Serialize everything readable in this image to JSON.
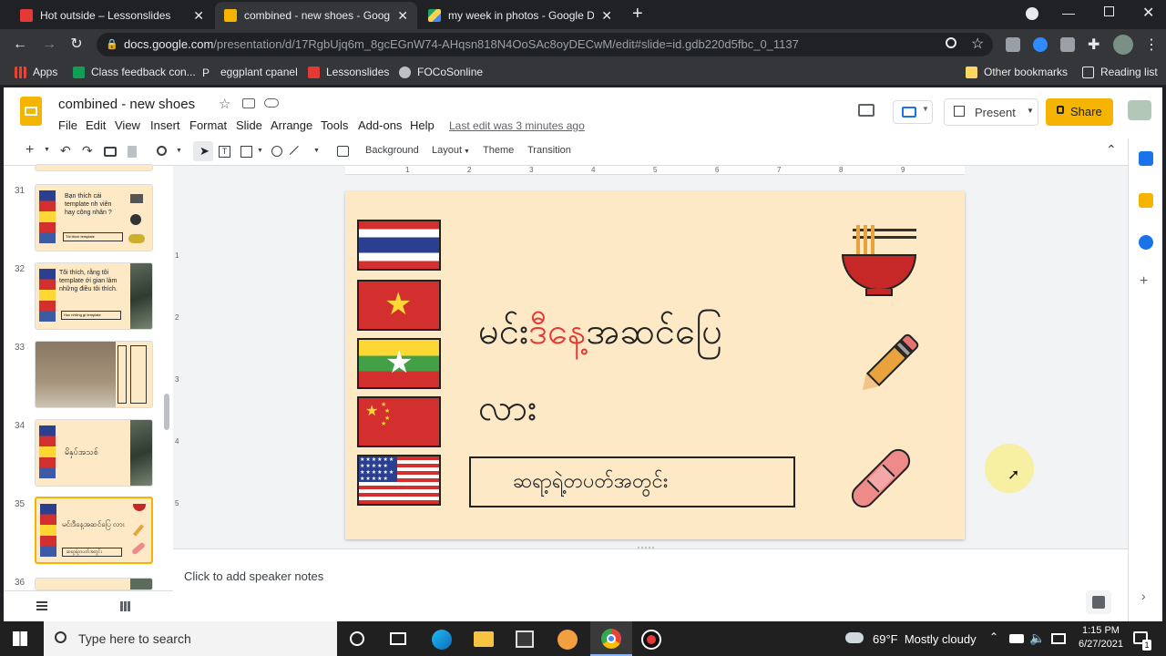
{
  "browser": {
    "tabs": [
      {
        "title": "Hot outside – Lessonslides",
        "active": false
      },
      {
        "title": "combined - new shoes - Google",
        "active": true
      },
      {
        "title": "my week in photos - Google Driv",
        "active": false
      }
    ],
    "new_tab": "+",
    "url_host": "docs.google.com",
    "url_path": "/presentation/d/17RgbUjq6m_8gcEGnW74-AHqsn818N4OoSAc8oyDECwM/edit#slide=id.gdb220d5fbc_0_1137",
    "bookmarks": [
      "Apps",
      "Class feedback con...",
      "eggplant cpanel",
      "Lessonslides",
      "FOCoSonline"
    ],
    "other_bookmarks": "Other bookmarks",
    "reading_list": "Reading list"
  },
  "slides_app": {
    "doc_title": "combined - new shoes",
    "menu": [
      "File",
      "Edit",
      "View",
      "Insert",
      "Format",
      "Slide",
      "Arrange",
      "Tools",
      "Add-ons",
      "Help"
    ],
    "last_edit": "Last edit was 3 minutes ago",
    "present_label": "Present",
    "share_label": "Share",
    "toolbar": {
      "background": "Background",
      "layout": "Layout",
      "theme": "Theme",
      "transition": "Transition"
    },
    "ruler_ticks": [
      "1",
      "2",
      "3",
      "4",
      "5",
      "6",
      "7",
      "8",
      "9"
    ],
    "ruler_left_ticks": [
      "1",
      "2",
      "3",
      "4",
      "5"
    ],
    "speaker_notes": "Click to add speaker notes"
  },
  "filmstrip": [
    {
      "num": "31",
      "text": "Bạn thích cái template nh viên hay công nhân ?",
      "sub": "Tôi thích template"
    },
    {
      "num": "32",
      "text": "Tôi thích, rằng tôi template ới gian làm những điều tôi thích.",
      "sub": "Học những gì template"
    },
    {
      "num": "33",
      "text": "",
      "sub": ""
    },
    {
      "num": "34",
      "text": "မိနှပ်အသစ်",
      "sub": ""
    },
    {
      "num": "35",
      "text": "မင်းဒီနေ့အဆင်ပြေ လား",
      "sub": "ဆရာ့ရဲ့တပတ်အတွင်း",
      "selected": true
    },
    {
      "num": "36",
      "text": "",
      "sub": ""
    }
  ],
  "slide": {
    "title_part1": "မင်း",
    "title_part2": "ဒီနေ့",
    "title_part3": "အဆင်ပြေ",
    "title_line2": "လား",
    "box_text": "ဆရာ့ရဲ့တပတ်အတွင်း",
    "highlight_color": "#e53935",
    "bg_color": "#fde9c6"
  },
  "taskbar": {
    "search_placeholder": "Type here to search",
    "weather_temp": "69°F",
    "weather_desc": "Mostly cloudy",
    "time": "1:15 PM",
    "date": "6/27/2021",
    "notification_count": "1"
  }
}
